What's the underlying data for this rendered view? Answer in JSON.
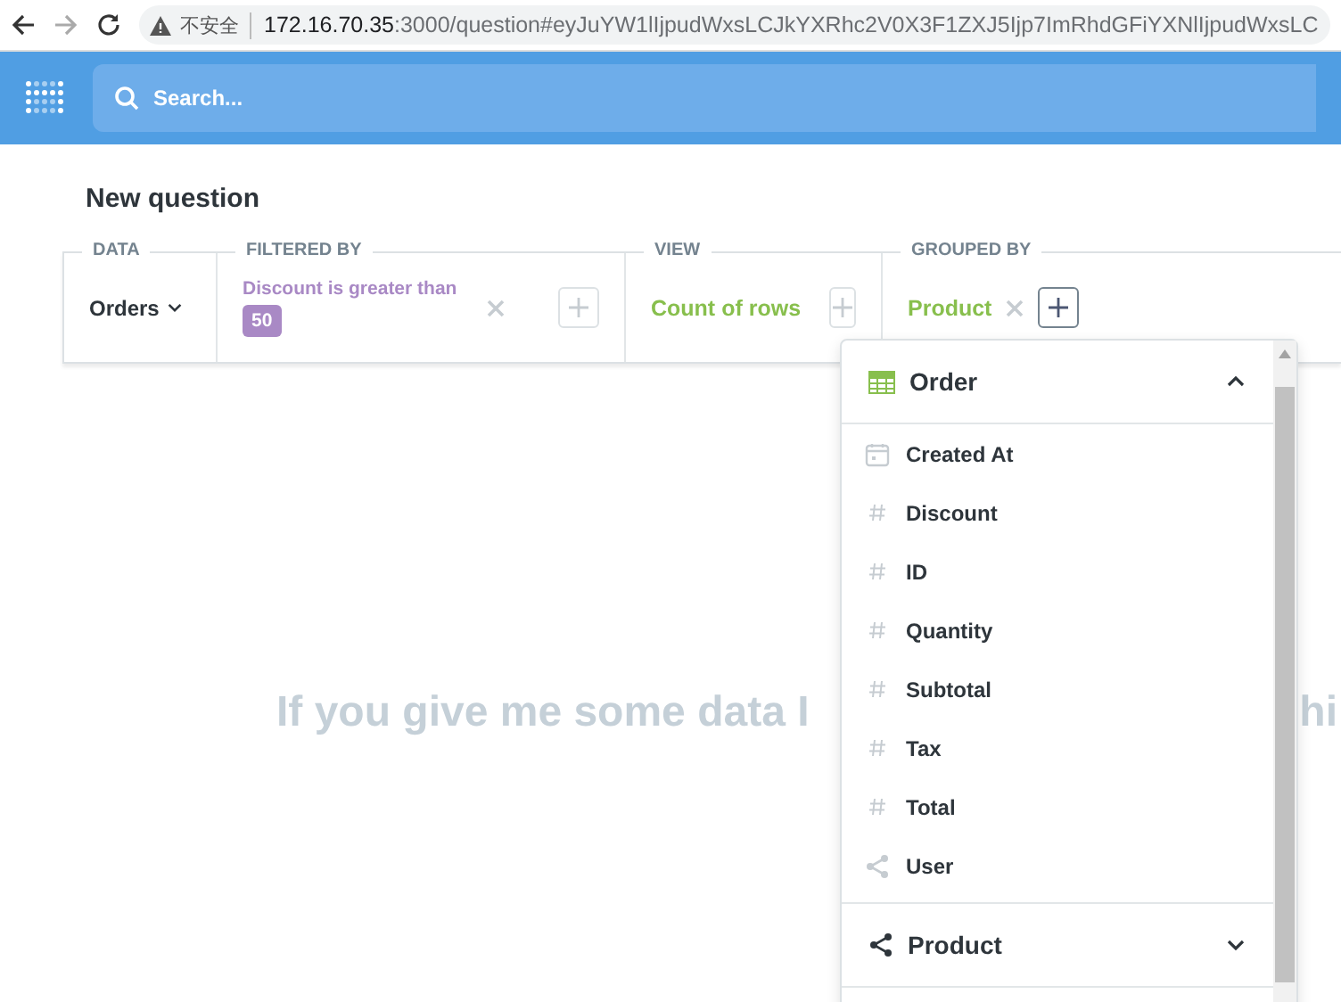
{
  "browser": {
    "security_label": "不安全",
    "url_host": "172.16.70.35",
    "url_path": ":3000/question#eyJuYW1lIjpudWxsLCJkYXRhc2V0X3F1ZXJ5Ijp7ImRhdGFiYXNlIjpudWxsLC"
  },
  "navbar": {
    "search": {
      "placeholder": "Search..."
    }
  },
  "title": "New question",
  "query": {
    "data": {
      "label": "DATA",
      "value": "Orders"
    },
    "filter": {
      "label": "FILTERED BY",
      "text": "Discount is greater than",
      "value": "50"
    },
    "view": {
      "label": "VIEW",
      "value": "Count of rows"
    },
    "group": {
      "label": "GROUPED BY",
      "value": "Product"
    }
  },
  "empty_message": {
    "left": "If you give me some data I",
    "right": "hi"
  },
  "field_picker": {
    "sections": [
      {
        "name": "Order",
        "kind": "table",
        "expanded": true,
        "fields": [
          {
            "name": "Created At",
            "kind": "date"
          },
          {
            "name": "Discount",
            "kind": "number"
          },
          {
            "name": "ID",
            "kind": "number"
          },
          {
            "name": "Quantity",
            "kind": "number"
          },
          {
            "name": "Subtotal",
            "kind": "number"
          },
          {
            "name": "Tax",
            "kind": "number"
          },
          {
            "name": "Total",
            "kind": "number"
          },
          {
            "name": "User",
            "kind": "link"
          }
        ]
      },
      {
        "name": "Product",
        "kind": "link",
        "expanded": false
      }
    ]
  }
}
